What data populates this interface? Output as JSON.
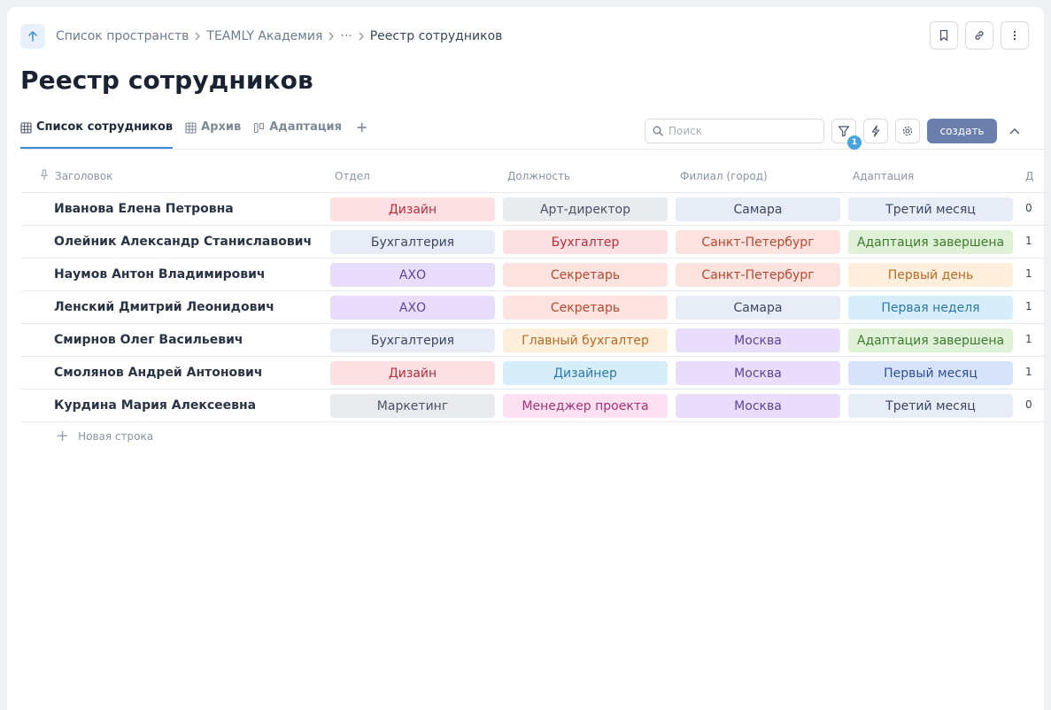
{
  "breadcrumbs": {
    "items": [
      "Список пространств",
      "TEAMLY Академия",
      "···",
      "Реестр сотрудников"
    ]
  },
  "page": {
    "title": "Реестр сотрудников"
  },
  "tabs": {
    "items": [
      {
        "label": "Список сотрудников",
        "icon": "table-icon",
        "active": true
      },
      {
        "label": "Архив",
        "icon": "table-icon",
        "active": false
      },
      {
        "label": "Адаптация",
        "icon": "board-icon",
        "active": false
      }
    ],
    "add": "+"
  },
  "toolbar": {
    "search_placeholder": "Поиск",
    "filter_count": "1",
    "create_label": "создать"
  },
  "table": {
    "columns": [
      "Заголовок",
      "Отдел",
      "Должность",
      "Филиал (город)",
      "Адаптация"
    ],
    "rows": [
      {
        "name": "Иванова Елена Петровна",
        "dept": "Дизайн",
        "dept_color": "red",
        "pos": "Арт-директор",
        "pos_color": "gray",
        "city": "Самара",
        "city_color": "blue",
        "adapt": "Третий месяц",
        "adapt_color": "blue",
        "cut": "0"
      },
      {
        "name": "Олейник Александр Станиславович",
        "dept": "Бухгалтерия",
        "dept_color": "blue",
        "pos": "Бухгалтер",
        "pos_color": "red",
        "city": "Санкт-Петербург",
        "city_color": "salmon",
        "adapt": "Адаптация завершена",
        "adapt_color": "green",
        "cut": "1"
      },
      {
        "name": "Наумов Антон Владимирович",
        "dept": "АХО",
        "dept_color": "lav",
        "pos": "Секретарь",
        "pos_color": "salmon",
        "city": "Санкт-Петербург",
        "city_color": "salmon",
        "adapt": "Первый день",
        "adapt_color": "orange",
        "cut": "1"
      },
      {
        "name": "Ленский Дмитрий Леонидович",
        "dept": "АХО",
        "dept_color": "lav",
        "pos": "Секретарь",
        "pos_color": "salmon",
        "city": "Самара",
        "city_color": "blue",
        "adapt": "Первая неделя",
        "adapt_color": "cyan",
        "cut": "1"
      },
      {
        "name": "Смирнов Олег Васильевич",
        "dept": "Бухгалтерия",
        "dept_color": "blue",
        "pos": "Главный бухгалтер",
        "pos_color": "orange",
        "city": "Москва",
        "city_color": "lav",
        "adapt": "Адаптация завершена",
        "adapt_color": "green",
        "cut": "1"
      },
      {
        "name": "Смолянов Андрей Антонович",
        "dept": "Дизайн",
        "dept_color": "red",
        "pos": "Дизайнер",
        "pos_color": "cyan",
        "city": "Москва",
        "city_color": "lav",
        "adapt": "Первый месяц",
        "adapt_color": "cobalt",
        "cut": "1"
      },
      {
        "name": "Курдина Мария Алексеевна",
        "dept": "Маркетинг",
        "dept_color": "gray",
        "pos": "Менеджер проекта",
        "pos_color": "pink",
        "city": "Москва",
        "city_color": "lav",
        "adapt": "Третий месяц",
        "adapt_color": "blue",
        "cut": "0"
      }
    ],
    "new_row_label": "Новая строка"
  }
}
